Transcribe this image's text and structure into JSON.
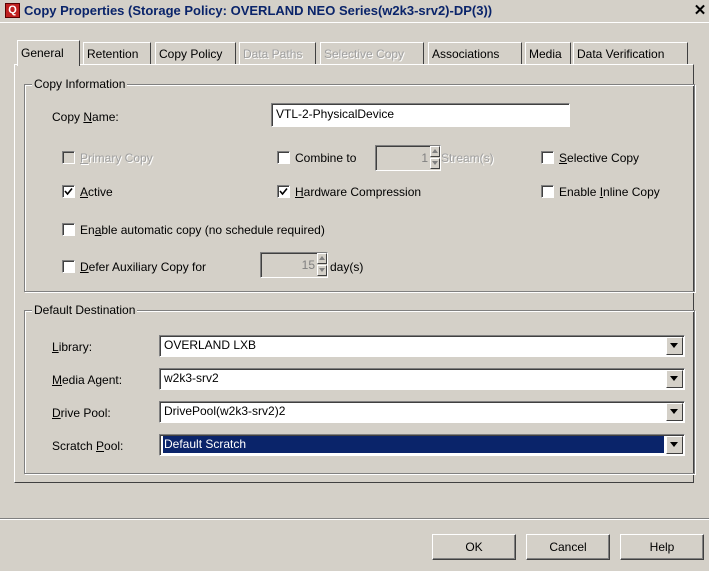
{
  "window": {
    "title": "Copy Properties (Storage Policy: OVERLAND NEO Series(w2k3-srv2)-DP(3))",
    "app_icon": "Q"
  },
  "tabs": [
    {
      "label": "General",
      "active": true,
      "disabled": false
    },
    {
      "label": "Retention",
      "active": false,
      "disabled": false
    },
    {
      "label": "Copy Policy",
      "active": false,
      "disabled": false
    },
    {
      "label": "Data Paths",
      "active": false,
      "disabled": true
    },
    {
      "label": "Selective Copy",
      "active": false,
      "disabled": true
    },
    {
      "label": "Associations",
      "active": false,
      "disabled": false
    },
    {
      "label": "Media",
      "active": false,
      "disabled": false
    },
    {
      "label": "Data Verification",
      "active": false,
      "disabled": false
    }
  ],
  "copy_info": {
    "group_label": "Copy Information",
    "copy_name_label": "Copy Name:",
    "copy_name_value": "VTL-2-PhysicalDevice",
    "primary_copy": {
      "label": "Primary Copy",
      "checked": false,
      "disabled": true
    },
    "combine_to": {
      "label": "Combine to",
      "checked": false,
      "value": "1",
      "suffix": "Stream(s)"
    },
    "selective_copy": {
      "label": "Selective Copy",
      "checked": false
    },
    "active": {
      "label": "Active",
      "checked": true
    },
    "hardware_compression": {
      "label": "Hardware Compression",
      "checked": true
    },
    "enable_inline_copy": {
      "label": "Enable Inline Copy",
      "checked": false
    },
    "enable_auto_copy": {
      "label": "Enable automatic copy (no schedule required)",
      "checked": false
    },
    "defer_aux": {
      "label": "Defer Auxiliary Copy for",
      "checked": false,
      "value": "15",
      "suffix": "day(s)"
    }
  },
  "default_destination": {
    "group_label": "Default Destination",
    "library": {
      "label": "Library:",
      "value": "OVERLAND LXB"
    },
    "media_agent": {
      "label": "Media Agent:",
      "value": "w2k3-srv2"
    },
    "drive_pool": {
      "label": "Drive Pool:",
      "value": "DrivePool(w2k3-srv2)2"
    },
    "scratch_pool": {
      "label": "Scratch Pool:",
      "value": "Default Scratch"
    }
  },
  "buttons": {
    "ok": "OK",
    "cancel": "Cancel",
    "help": "Help"
  },
  "colors": {
    "selection": "#0a246a",
    "dialog_bg": "#d4d0c8",
    "title_text": "#0a246a"
  }
}
